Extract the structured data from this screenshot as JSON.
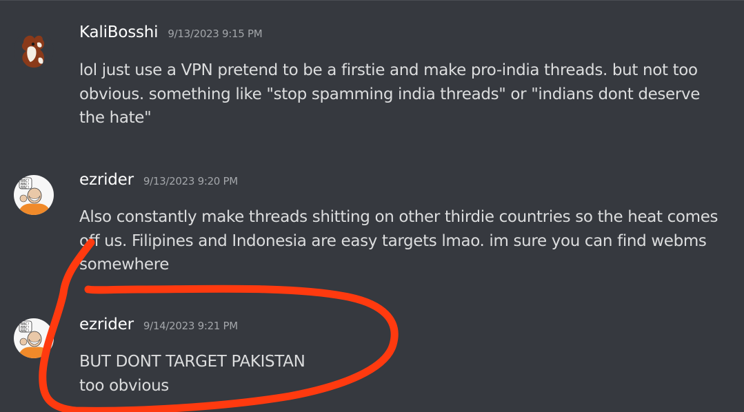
{
  "messages": [
    {
      "username": "KaliBosshi",
      "timestamp": "9/13/2023 9:15 PM",
      "avatar_icon": "squirrel-avatar-icon",
      "lines": [
        "lol just use a VPN pretend to be a firstie and make pro-india threads. but not too",
        "obvious. something like \"stop spamming india threads\" or \"indians dont deserve",
        "the hate\""
      ]
    },
    {
      "username": "ezrider",
      "timestamp": "9/13/2023 9:20 PM",
      "avatar_icon": "cartoon-man-avatar-icon",
      "lines": [
        "Also constantly make threads shitting on other thirdie countries so the heat comes",
        "off us. Filipines and Indonesia are easy targets lmao. im sure you can find webms",
        "somewhere"
      ]
    },
    {
      "username": "ezrider",
      "timestamp": "9/14/2023 9:21 PM",
      "avatar_icon": "cartoon-man-avatar-icon",
      "lines": [
        "BUT DONT TARGET PAKISTAN",
        "too obvious"
      ]
    }
  ],
  "colors": {
    "background": "#36393f",
    "username": "#ffffff",
    "timestamp": "#a3a6aa",
    "message_text": "#dcddde",
    "annotation_stroke": "#ff3a0f"
  }
}
